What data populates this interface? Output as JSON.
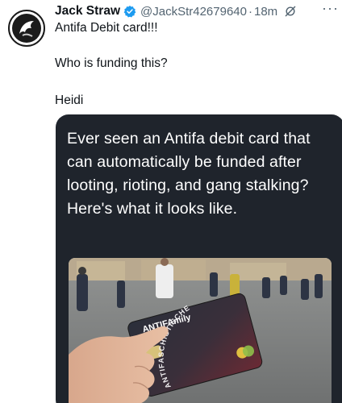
{
  "tweet": {
    "display_name": "Jack Straw",
    "handle": "@JackStr42679640",
    "separator": "·",
    "time": "18m",
    "more_label": "···",
    "lines": [
      "Antifa Debit card!!!",
      "Who is funding this?",
      "Heidi"
    ]
  },
  "media": {
    "caption": "Ever seen an Antifa debit card that can automatically be funded after looting, rioting, and gang stalking? Here's what it looks like.",
    "card": {
      "brand": "ANTIFAmily",
      "subtitle": "Mitgliedskarte",
      "ring_text": "ANTIFASCHISTISCHE"
    }
  },
  "colors": {
    "verified_blue": "#1d9bf0",
    "media_bg": "#1f242c",
    "secondary_text": "#536471"
  },
  "icons": [
    "avatar-logo-icon",
    "verified-badge-icon",
    "grok-icon",
    "more-icon"
  ]
}
